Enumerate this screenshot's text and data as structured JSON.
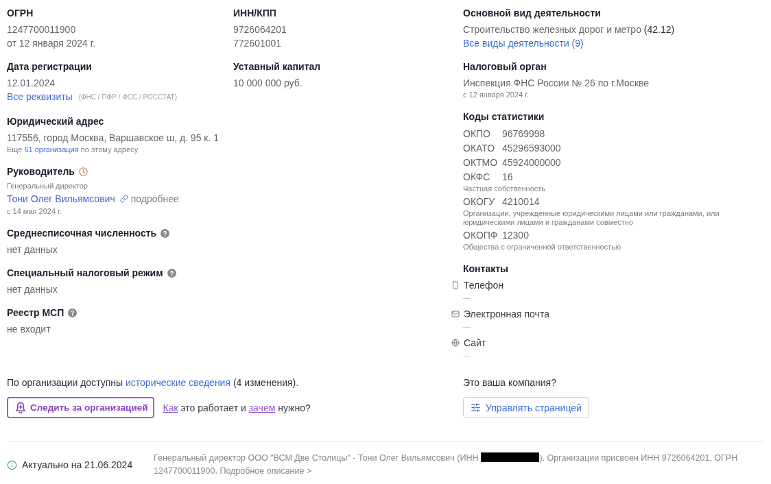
{
  "column_1": [
    {
      "label": "ОГРН",
      "lines": [
        {
          "kind": "value",
          "text": "1247700011900"
        },
        {
          "kind": "value",
          "text": "от 12 января 2024 г."
        }
      ]
    },
    {
      "label": "Дата регистрации",
      "lines": [
        {
          "kind": "value",
          "text": "12.01.2024"
        },
        {
          "kind": "link_note",
          "text": "Все реквизиты",
          "note": "(ФНС / ПФР / ФСС / РОССТАТ)"
        }
      ]
    },
    {
      "label": "Юридический адрес",
      "lines": [
        {
          "kind": "value",
          "text": "117556, город Москва, Варшавское ш, д. 95 к. 1"
        },
        {
          "kind": "note",
          "before": "Еще",
          "link": "61 организация",
          "after": "по этому адресу"
        }
      ]
    },
    {
      "label": "Руководитель",
      "has_history": true,
      "lines": [
        {
          "kind": "small",
          "text": "Генеральный директор"
        },
        {
          "kind": "person",
          "text": "Тони Олег Вильямсович",
          "more": "подробнее"
        },
        {
          "kind": "small",
          "text": "с 14 мая 2024 г."
        }
      ]
    },
    {
      "label": "Среднесписочная численность",
      "has_help": true,
      "lines": [
        {
          "kind": "value",
          "text": "нет данных"
        }
      ]
    },
    {
      "label": "Специальный налоговый режим",
      "has_help": true,
      "lines": [
        {
          "kind": "value",
          "text": "нет данных"
        }
      ]
    },
    {
      "label": "Реестр МСП",
      "has_help": true,
      "lines": [
        {
          "kind": "value",
          "text": "не входит"
        }
      ]
    }
  ],
  "column_2": [
    {
      "label": "ИНН/КПП",
      "lines": [
        {
          "kind": "value",
          "text": "9726064201"
        },
        {
          "kind": "value",
          "text": "772601001"
        }
      ]
    },
    {
      "label": "Уставный капитал",
      "lines": [
        {
          "kind": "value",
          "text": "10 000 000 руб."
        }
      ]
    }
  ],
  "column_3": [
    {
      "label": "Основной вид деятельности",
      "lines": [
        {
          "kind": "value",
          "text": "Строительство железных дорог и метро",
          "suffix": "(42.12)"
        },
        {
          "kind": "link",
          "text": "Все виды деятельности (9)"
        }
      ]
    },
    {
      "label": "Налоговый орган",
      "lines": [
        {
          "kind": "value",
          "text": "Инспекция ФНС России № 26 по г.Москве"
        },
        {
          "kind": "small",
          "text": "с 12 января 2024 г."
        }
      ]
    },
    {
      "label": "Коды статистики",
      "lines": [
        {
          "kind": "code",
          "code": "ОКПО",
          "value": "96769998"
        },
        {
          "kind": "code",
          "code": "ОКАТО",
          "value": "45296593000"
        },
        {
          "kind": "code",
          "code": "ОКТМО",
          "value": "45924000000"
        },
        {
          "kind": "code",
          "code": "ОКФС",
          "value": "16"
        },
        {
          "kind": "small",
          "text": "Частная собственность"
        },
        {
          "kind": "code",
          "code": "ОКОГУ",
          "value": "4210014"
        },
        {
          "kind": "small",
          "text": "Организации, учрежденные юридическими лицами или гражданами, или юридическими лицами и гражданами совместно"
        },
        {
          "kind": "code",
          "code": "ОКОПФ",
          "value": "12300"
        },
        {
          "kind": "small",
          "text": "Общества с ограниченной ответственностью"
        }
      ]
    },
    {
      "label": "Контакты",
      "lines": [
        {
          "kind": "phone",
          "text": "Телефон",
          "value": "—"
        },
        {
          "kind": "email",
          "text": "Электронная почта",
          "value": "—"
        },
        {
          "kind": "website",
          "text": "Сайт",
          "value": "—"
        }
      ]
    }
  ],
  "history": {
    "before": "По организации доступны",
    "link": "исторические сведения",
    "after": "(4 изменения)."
  },
  "follow": {
    "button": "Следить за организацией",
    "link_1": "Как",
    "middle": "это работает и",
    "link_2": "зачем",
    "end": "нужно?"
  },
  "claim": {
    "question": "Это ваша компания?",
    "button": "Управлять страницей"
  },
  "footer": {
    "status": "Актуально на 21.06.2024",
    "before": "Генеральный директор ООО \"ВСМ Две Столицы\" - Тони Олег Вильямсович (ИНН",
    "redacted": true,
    "after": "). Организации присвоен ИНН 9726064201, ОГРН 1247700011900.",
    "link": "Подробное описание >"
  }
}
